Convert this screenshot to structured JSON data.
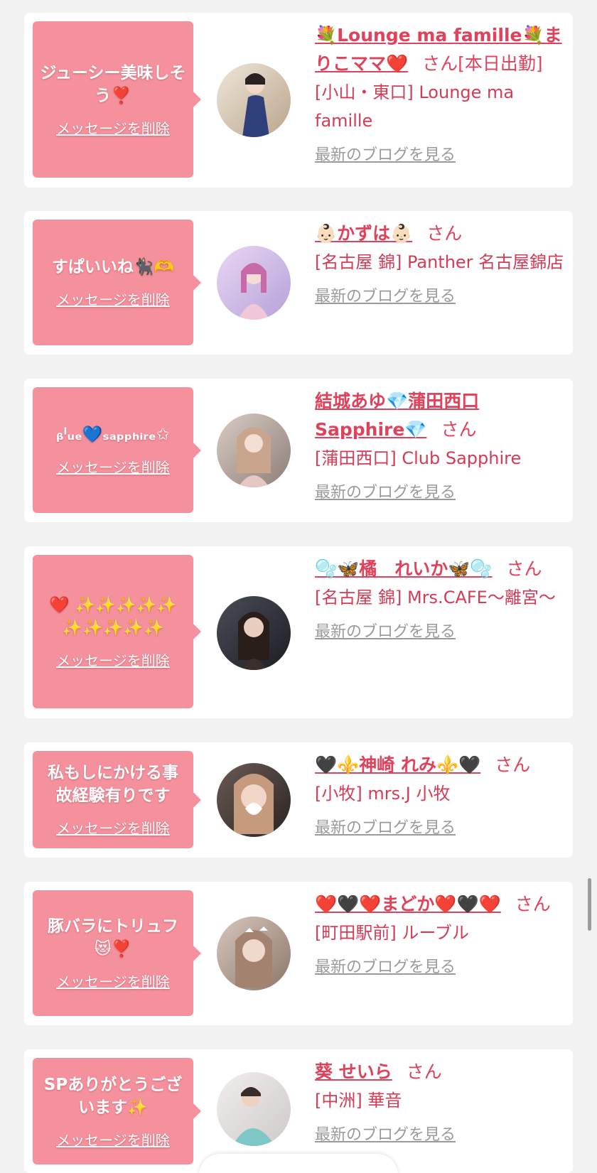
{
  "colors": {
    "background": "#f2f2f2",
    "card": "#ffffff",
    "bubble": "#f5909d",
    "name": "#e0415b",
    "link_gray": "#9a9a9a"
  },
  "entries": [
    {
      "message": "ジューシー美味しそう❣️",
      "delete_label": "メッセージを削除",
      "name": "💐Lounge ma famille💐まりこママ❤️",
      "honorific": "さん",
      "status": "[本日出勤]",
      "shop": "[小山・東口] Lounge ma famille",
      "blog_label": "最新のブログを見る"
    },
    {
      "message": "すぱいいね🐈‍⬛🫶",
      "delete_label": "メッセージを削除",
      "name": "👶🏻かずは👶🏻",
      "honorific": "さん",
      "status": "",
      "shop": "[名古屋 錦] Panther 名古屋錦店",
      "blog_label": "最新のブログを見る"
    },
    {
      "message": "ᵦˡᵤₑ💙ₛₐₚₚₕᵢᵣₑ✩",
      "delete_label": "メッセージを削除",
      "name": "結城あゆ💎蒲田西口Sapphire💎",
      "honorific": "さん",
      "status": "",
      "shop": "[蒲田西口] Club Sapphire",
      "blog_label": "最新のブログを見る"
    },
    {
      "message": "❤️ ✨✨✨✨✨✨✨✨✨✨",
      "delete_label": "メッセージを削除",
      "name": "🫧🦋橘　れいか🦋🫧",
      "honorific": "さん",
      "status": "",
      "shop": "[名古屋 錦] Mrs.CAFE〜離宮〜",
      "blog_label": "最新のブログを見る"
    },
    {
      "message": "私もしにかける事故経験有りです",
      "delete_label": "メッセージを削除",
      "name": "🖤⚜️神崎 れみ⚜️🖤",
      "honorific": "さん",
      "status": "",
      "shop": "[小牧] mrs.J 小牧",
      "blog_label": "最新のブログを見る"
    },
    {
      "message": "豚バラにトリュフ😻❣️",
      "delete_label": "メッセージを削除",
      "name": "❤️🖤❤️まどか❤️🖤❤️",
      "honorific": "さん",
      "status": "",
      "shop": "[町田駅前] ルーブル",
      "blog_label": "最新のブログを見る"
    },
    {
      "message": "SPありがとうございます✨",
      "delete_label": "メッセージを削除",
      "name": "葵 せいら",
      "honorific": "さん",
      "status": "",
      "shop": "[中洲] 華音",
      "blog_label": "最新のブログを見る"
    }
  ]
}
